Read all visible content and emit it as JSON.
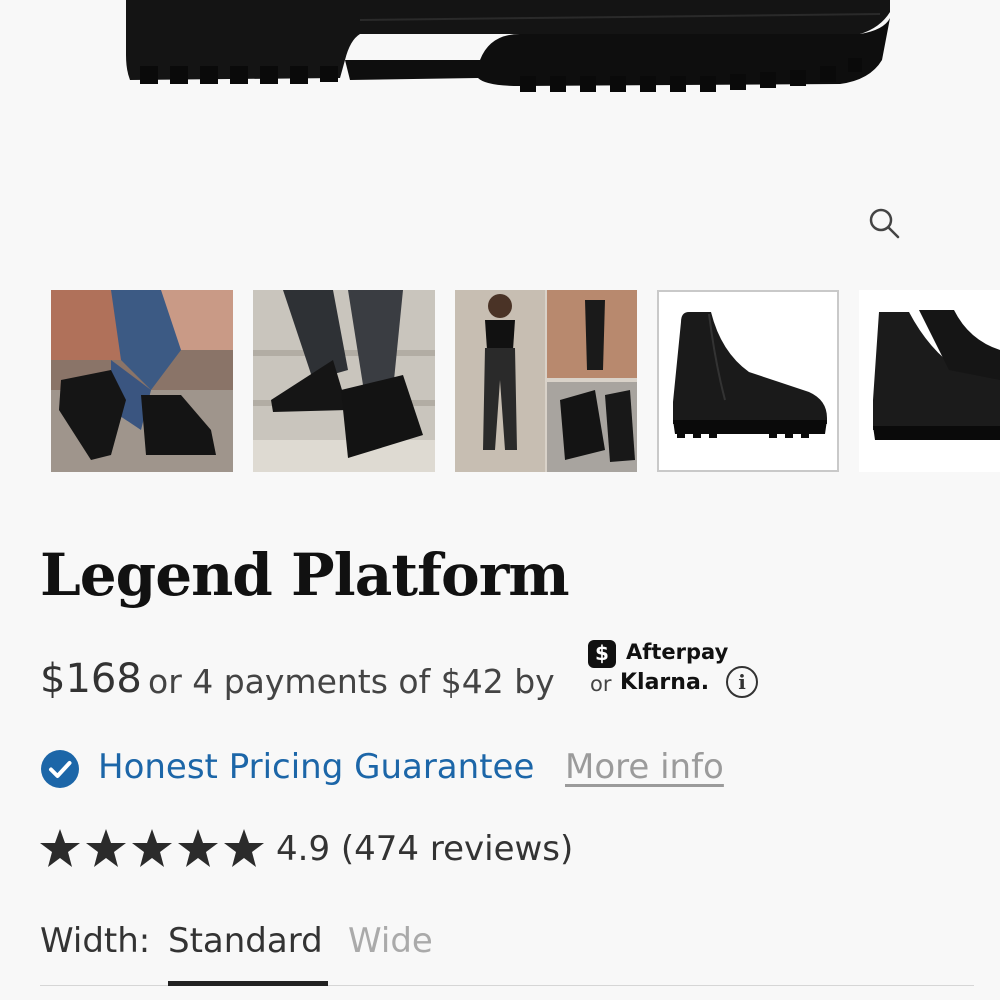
{
  "product": {
    "title": "Legend Platform",
    "price": "$168",
    "installments": "or 4 payments of $42 by"
  },
  "payment_providers": {
    "afterpay_symbol": "$",
    "afterpay": "Afterpay",
    "or": "or",
    "klarna": "Klarna."
  },
  "info_symbol": "i",
  "guarantee": {
    "label": "Honest Pricing Guarantee",
    "link": "More info"
  },
  "rating": {
    "stars": 5,
    "text": "4.9 (474 reviews)"
  },
  "width_selector": {
    "label": "Width:",
    "options": [
      "Standard",
      "Wide"
    ],
    "selected": "Standard"
  },
  "gallery": {
    "thumbnails": [
      "walking-street",
      "stairs-closeup",
      "outfit-collage",
      "boot-side-view",
      "boot-pair-partial"
    ],
    "selected_index": 3
  },
  "icons": [
    "zoom-icon",
    "info-icon",
    "verified-check-icon",
    "star-icon",
    "afterpay-icon"
  ],
  "colors": {
    "accent_blue": "#1c66a8",
    "link_gray": "#9b9b9b",
    "text_dark": "#111111"
  }
}
